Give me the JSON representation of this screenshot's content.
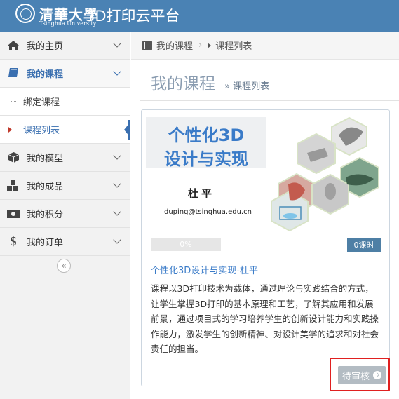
{
  "header": {
    "logo_cn": "清華大學",
    "logo_en": "Tsinghua University",
    "app_title": "3D打印云平台"
  },
  "sidebar": {
    "items": [
      {
        "label": "我的主页",
        "icon": "home-icon"
      },
      {
        "label": "我的课程",
        "icon": "book-icon",
        "active": true
      },
      {
        "label": "绑定课程",
        "sub": true
      },
      {
        "label": "课程列表",
        "sub": true,
        "current": true
      },
      {
        "label": "我的模型",
        "icon": "cube-icon"
      },
      {
        "label": "我的成品",
        "icon": "cubes-icon"
      },
      {
        "label": "我的积分",
        "icon": "money-icon"
      },
      {
        "label": "我的订单",
        "icon": "dollar-icon"
      }
    ],
    "collapse_icon": "double-chevron-left-icon"
  },
  "breadcrumb": {
    "root": "我的课程",
    "current": "课程列表"
  },
  "page": {
    "title": "我的课程",
    "subtitle": "» 课程列表"
  },
  "course": {
    "cover_title_line1": "个性化3D",
    "cover_title_line2": "设计与实现",
    "cover_author": "杜平",
    "cover_email": "duping@tsinghua.edu.cn",
    "progress_text": "0%",
    "progress_fraction": 0,
    "hours_badge": "0课时",
    "name": "个性化3D设计与实现-杜平",
    "description": "课程以3D打印技术为载体，通过理论与实践结合的方式，让学生掌握3D打印的基本原理和工艺，了解其应用和发展前景，通过项目式的学习培养学生的创新设计能力和实践操作能力，激发学生的创新精神、对设计美学的追求和对社会责任的担当。",
    "status_button": "待审核"
  },
  "colors": {
    "topbar": "#4a82b4",
    "accent": "#3a7bc8",
    "highlight": "#e02020",
    "badge": "#4e7fa5",
    "status_button": "#b3bcc3"
  }
}
